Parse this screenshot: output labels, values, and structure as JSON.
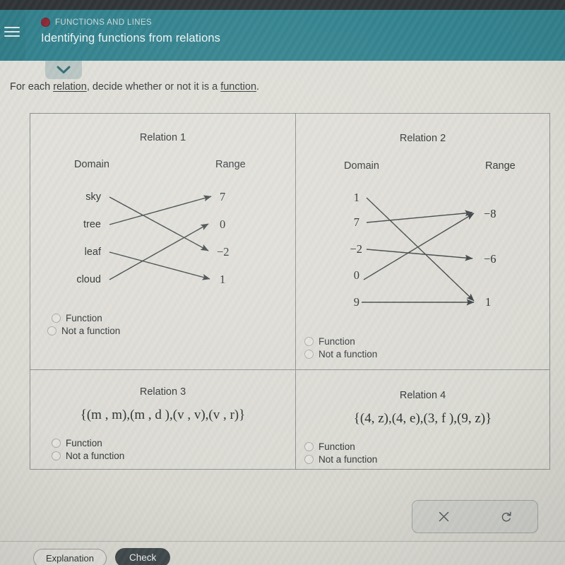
{
  "header": {
    "eyebrow": "FUNCTIONS AND LINES",
    "eyebrow_icon": "record-circle-icon",
    "title": "Identifying functions from relations",
    "menu_icon": "hamburger-menu-icon",
    "collapse_icon": "chevron-down-icon",
    "bg_color": "#2e808d",
    "eyebrow_dot_color": "#8c2230"
  },
  "prompt": {
    "before": "For each ",
    "link1": "relation",
    "middle": ", decide whether or not it is a ",
    "link2": "function",
    "after": "."
  },
  "choices": {
    "function": "Function",
    "not_a_function": "Not a function"
  },
  "relations": [
    {
      "title": "Relation 1",
      "type": "mapping",
      "domain_label": "Domain",
      "range_label": "Range",
      "domain": [
        "sky",
        "tree",
        "leaf",
        "cloud"
      ],
      "range": [
        "7",
        "0",
        "−2",
        "1"
      ],
      "pairs": [
        {
          "from": "sky",
          "to": "−2"
        },
        {
          "from": "tree",
          "to": "7"
        },
        {
          "from": "leaf",
          "to": "1"
        },
        {
          "from": "cloud",
          "to": "0"
        }
      ]
    },
    {
      "title": "Relation 2",
      "type": "mapping",
      "domain_label": "Domain",
      "range_label": "Range",
      "domain": [
        "1",
        "7",
        "−2",
        "0",
        "9"
      ],
      "range": [
        "−8",
        "−6",
        "1"
      ],
      "pairs": [
        {
          "from": "1",
          "to": "1"
        },
        {
          "from": "7",
          "to": "−8"
        },
        {
          "from": "−2",
          "to": "−6"
        },
        {
          "from": "0",
          "to": "−8"
        },
        {
          "from": "9",
          "to": "1"
        }
      ]
    },
    {
      "title": "Relation 3",
      "type": "set",
      "set_notation": "{(m , m),(m , d ),(v , v),(v , r)}"
    },
    {
      "title": "Relation 4",
      "type": "set",
      "set_notation": "{(4, z),(4, e),(3, f ),(9, z)}"
    }
  ],
  "tools": {
    "clear_icon": "x-close-icon",
    "undo_icon": "undo-refresh-icon"
  },
  "footer": {
    "explanation": "Explanation",
    "check": "Check"
  }
}
